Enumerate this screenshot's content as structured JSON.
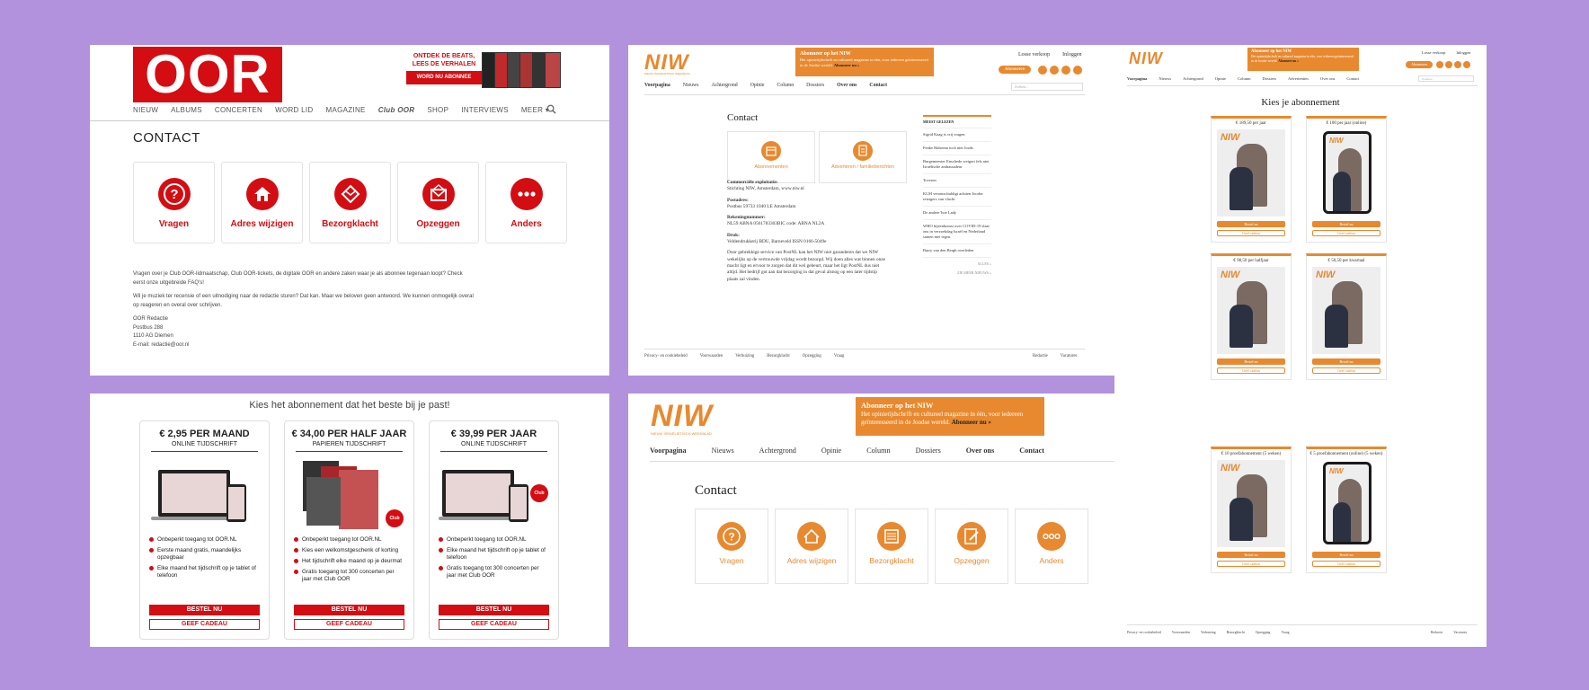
{
  "oor_contact": {
    "logo": "OOR",
    "promo_line1": "ONTDEK DE BEATS,",
    "promo_line2": "LEES DE VERHALEN",
    "promo_button": "WORD NU ABONNEE",
    "nav": [
      "NIEUW",
      "ALBUMS",
      "CONCERTEN",
      "WORD LID",
      "MAGAZINE",
      "Club OOR",
      "SHOP",
      "INTERVIEWS",
      "MEER"
    ],
    "title": "CONTACT",
    "cards": [
      {
        "label": "Vragen",
        "icon": "question-icon"
      },
      {
        "label": "Adres wijzigen",
        "icon": "home-icon"
      },
      {
        "label": "Bezorgklacht",
        "icon": "package-icon"
      },
      {
        "label": "Opzeggen",
        "icon": "envelope-icon"
      },
      {
        "label": "Anders",
        "icon": "dots-icon"
      }
    ],
    "para1": "Vragen over je Club OOR-lidmaatschap, Club OOR-tickets, de digitale OOR en andere zaken waar je als abonnee tegenaan loopt? Check eerst onze uitgebreide FAQ's!",
    "para2": "Wil je muziek ter recensie of een uitnodiging naar de redactie sturen? Dat kan. Maar we beloven geen antwoord. We kunnen onmogelijk overal op reageren en overal over schrijven.",
    "address": [
      "OOR Redactie",
      "Postbus 288",
      "1110 AG Diemen",
      "E-mail: redactie@oor.nl"
    ]
  },
  "oor_subs": {
    "heading": "Kies het abonnement dat het beste bij je past!",
    "plans": [
      {
        "price": "€ 2,95 PER MAAND",
        "type": "ONLINE TIJDSCHRIFT",
        "features": [
          "Onbeperkt toegang tot OOR.NL",
          "Eerste maand gratis, maandelijks opzegbaar",
          "Elke maand het tijdschrift op je tablet of telefoon"
        ],
        "btn1": "BESTEL NU",
        "btn2": "GEEF CADEAU"
      },
      {
        "price": "€ 34,00 PER HALF JAAR",
        "type": "PAPIEREN TIJDSCHRIFT",
        "features": [
          "Onbeperkt toegang tot OOR.NL",
          "Kies een welkomstgeschenk of korting",
          "Het tijdschrift elke maand op je deurmat",
          "Gratis toegang tot 300 concerten per jaar met Club OOR"
        ],
        "btn1": "BESTEL NU",
        "btn2": "GEEF CADEAU"
      },
      {
        "price": "€ 39,99 PER JAAR",
        "type": "ONLINE TIJDSCHRIFT",
        "features": [
          "Onbeperkt toegang tot OOR.NL",
          "Elke maand het tijdschrift op je tablet of telefoon",
          "Gratis toegang tot 300 concerten per jaar met Club OOR"
        ],
        "btn1": "BESTEL NU",
        "btn2": "GEEF CADEAU"
      }
    ],
    "club_badge": "Club OOR"
  },
  "niw_small": {
    "logo": "NIW",
    "logo_sub": "NIEUW ISRAËLIETISCH WEEKBLAD",
    "banner_title": "Abonneer op het NIW",
    "banner_text": "Het opinietijdschrift en cultureel magazine in één, voor iedereen geïnteresseerd in de Joodse wereld.",
    "banner_link": "Abonneer nu »",
    "top_links": [
      "Losse verkoop",
      "Inloggen"
    ],
    "pill": "Abonneren",
    "search": "Zoeken...",
    "nav": [
      "Voorpagina",
      "Nieuws",
      "Achtergrond",
      "Opinie",
      "Column",
      "Dossiers",
      "Over ons",
      "Contact"
    ],
    "title": "Contact",
    "cards": [
      {
        "label": "Abonnementen"
      },
      {
        "label": "Adverteren / familieberichten"
      }
    ],
    "info": [
      {
        "head": "Commerciële exploitatie:",
        "text": "Stichting NIW, Amsterdam, www.niw.nl"
      },
      {
        "head": "Postadres:",
        "text": "Postbus 59733 1040 LE Amsterdam"
      },
      {
        "head": "Rekeningnummer:",
        "text": "NL59 ABNA 0561783303BIC code: ABNA NL2A"
      },
      {
        "head": "Druk:",
        "text": "Veldendrukkerij BDU, Barneveld ISSN 0166-5049e"
      }
    ],
    "info_para": "Door gebrekkige service van PostNL kan het NIW niet garanderen dat we NIW wekelijks op de vertrouwde vrijdag wordt bezorgd. Wij doen alles wat binnen onze macht ligt en ervoor te zorgen dat dit wel gebeurt, maar het ligt PostNL dus niet altijd. Het bedrijf got aan dat bezorging in dat geval alsnog op een later tijdstip plaats zal vinden.",
    "side_head": "MEEST GELEZEN",
    "side_items": [
      "Sigrid Kaag is vrij vragen",
      "Fenke Halsema toch niet Joods",
      "Burgemeester Enschede weigert fels niet Israëlische ambassadeur",
      "Toveren",
      "KLM verontschuldigt achtien Joodse reizigers van vlucht",
      "De andere 'hoe Lady",
      "WHO bijeenkomst over COVID-19 slaat ons in verzoekdag Israël en Nederland samen met tegen.",
      "Barry van den Bergh overleden"
    ],
    "side_more": "ALLES »",
    "side_more2": "ZIE MEER NIEUWS »",
    "footer": [
      "Privacy- en cookiebeleid",
      "Voorwaarden",
      "Verhuizing",
      "Bezorgklacht",
      "Opzegging",
      "Vraag",
      "Redactie",
      "Vacatures"
    ]
  },
  "niw_big": {
    "logo": "NIW",
    "logo_sub": "NIEUW ISRAËLIETISCH WEEKBLAD",
    "banner_title": "Abonneer op het NIW",
    "banner_text": "Het opinietijdschrift en cultureel magazine in één, voor iedereen geïnteresseerd in de Joodse wereld.",
    "banner_link": "Abonneer nu »",
    "nav": [
      "Voorpagina",
      "Nieuws",
      "Achtergrond",
      "Opinie",
      "Column",
      "Dossiers",
      "Over ons",
      "Contact"
    ],
    "title": "Contact",
    "cards": [
      {
        "label": "Vragen",
        "icon": "question-icon"
      },
      {
        "label": "Adres wijzigen",
        "icon": "home-icon"
      },
      {
        "label": "Bezorgklacht",
        "icon": "document-icon"
      },
      {
        "label": "Opzeggen",
        "icon": "edit-icon"
      },
      {
        "label": "Anders",
        "icon": "dots-icon"
      }
    ]
  },
  "niw_subs": {
    "logo": "NIW",
    "banner_title": "Abonneer op het NIW",
    "banner_text": "Het opinietijdschrift en cultureel magazine in één, voor iedereen geïnteresseerd in de Joodse wereld.",
    "banner_link": "Abonneer nu »",
    "top_links": [
      "Losse verkoop",
      "Inloggen"
    ],
    "pill": "Abonneren",
    "search": "Zoeken...",
    "nav": [
      "Voorpagina",
      "Nieuws",
      "Achtergrond",
      "Opinie",
      "Column",
      "Dossiers",
      "Advertenties",
      "Over ons",
      "Contact"
    ],
    "title": "Kies je abonnement",
    "cards": [
      {
        "price": "€ 189,50 per jaar",
        "kind": "print"
      },
      {
        "price": "€ 100 per jaar (online)",
        "kind": "tablet"
      },
      {
        "price": "€ 98,50 per halfjaar",
        "kind": "print"
      },
      {
        "price": "€ 50,50 per kwartaal",
        "kind": "print"
      },
      {
        "price": "€ 10 proefabonnement (5 weken)",
        "kind": "print"
      },
      {
        "price": "€ 5 proefabonnement (online) (5 weken)",
        "kind": "tablet"
      }
    ],
    "btn1": "Bestel nu",
    "btn2": "Geef cadeau",
    "footer": [
      "Privacy- en cookiebeleid",
      "Voorwaarden",
      "Verhuizing",
      "Bezorgklacht",
      "Opzegging",
      "Vraag",
      "Redactie",
      "Vacatures"
    ]
  },
  "colors": {
    "background": "#b291dd",
    "oor_red": "#d40d12",
    "niw_orange": "#e8892f"
  }
}
